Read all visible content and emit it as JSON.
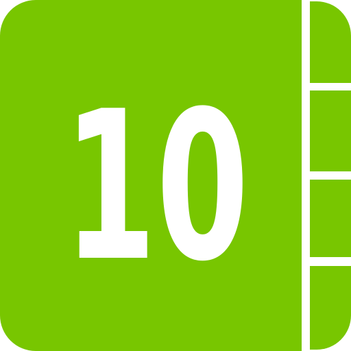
{
  "app_icon": {
    "number": "10",
    "icon_name": "contacts-book-icon",
    "colors": {
      "primary": "#78C600",
      "number": "#ffffff",
      "divider": "#ffffff"
    }
  }
}
